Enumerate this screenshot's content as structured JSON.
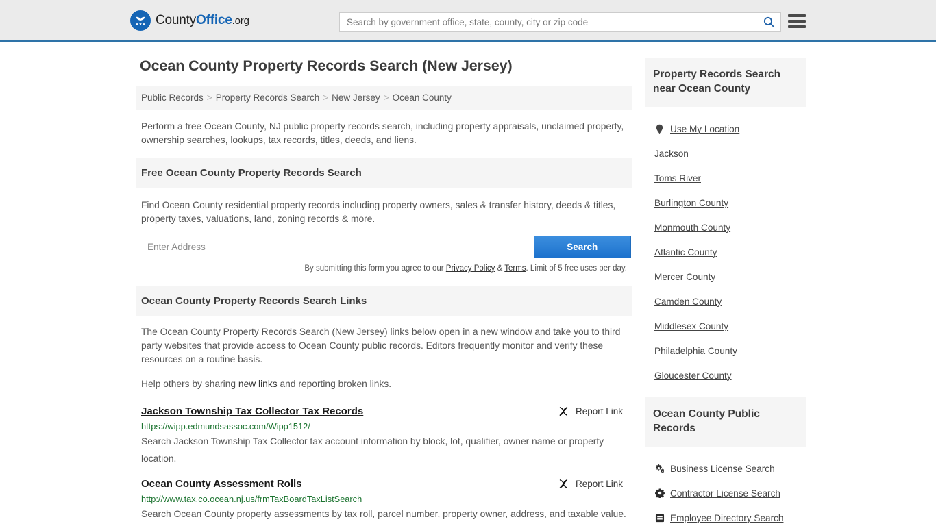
{
  "header": {
    "brand": {
      "part1": "County",
      "part2": "Office",
      "part3": ".org"
    },
    "search": {
      "placeholder": "Search by government office, state, county, city or zip code",
      "value": "",
      "icon": "search-icon"
    },
    "menu_icon": "hamburger-menu-icon",
    "accent_color": "#2e73a8"
  },
  "main": {
    "page_title": "Ocean County Property Records Search (New Jersey)",
    "breadcrumb": [
      "Public Records",
      "Property Records Search",
      "New Jersey",
      "Ocean County"
    ],
    "breadcrumb_separator": ">",
    "intro": "Perform a free Ocean County, NJ public property records search, including property appraisals, unclaimed property, ownership searches, lookups, tax records, titles, deeds, and liens.",
    "free_search": {
      "heading": "Free Ocean County Property Records Search",
      "description": "Find Ocean County residential property records including property owners, sales & transfer history, deeds & titles, property taxes, valuations, land, zoning records & more.",
      "input_placeholder": "Enter Address",
      "input_value": "",
      "submit_label": "Search",
      "terms_prefix": "By submitting this form you agree to our ",
      "terms_privacy": "Privacy Policy",
      "terms_amp": " & ",
      "terms_terms": "Terms",
      "terms_suffix": ". Limit of 5 free uses per day."
    },
    "links_section": {
      "heading": "Ocean County Property Records Search Links",
      "description": "The Ocean County Property Records Search (New Jersey) links below open in a new window and take you to third party websites that provide access to Ocean County public records. Editors frequently monitor and verify these resources on a routine basis.",
      "help_prefix": "Help others by sharing ",
      "help_link": "new links",
      "help_suffix": " and reporting broken links.",
      "report_label": "Report Link",
      "report_icon": "unlink-icon"
    },
    "results": [
      {
        "title": "Jackson Township Tax Collector Tax Records",
        "url": "https://wipp.edmundsassoc.com/Wipp1512/",
        "description": "Search Jackson Township Tax Collector tax account information by block, lot, qualifier, owner name or property location.",
        "report_label": "Report Link"
      },
      {
        "title": "Ocean County Assessment Rolls",
        "url": "http://www.tax.co.ocean.nj.us/frmTaxBoardTaxListSearch",
        "description": "Search Ocean County property assessments by tax roll, parcel number, property owner, address, and taxable value.",
        "report_label": "Report Link"
      }
    ]
  },
  "sidebar": {
    "nearby": {
      "heading": "Property Records Search near Ocean County",
      "items": [
        {
          "label": "Use My Location",
          "icon": "map-pin-icon"
        },
        {
          "label": "Jackson",
          "icon": ""
        },
        {
          "label": "Toms River",
          "icon": ""
        },
        {
          "label": "Burlington County",
          "icon": ""
        },
        {
          "label": "Monmouth County",
          "icon": ""
        },
        {
          "label": "Atlantic County",
          "icon": ""
        },
        {
          "label": "Mercer County",
          "icon": ""
        },
        {
          "label": "Camden County",
          "icon": ""
        },
        {
          "label": "Middlesex County",
          "icon": ""
        },
        {
          "label": "Philadelphia County",
          "icon": ""
        },
        {
          "label": "Gloucester County",
          "icon": ""
        }
      ]
    },
    "public_records": {
      "heading": "Ocean County Public Records",
      "items": [
        {
          "label": "Business License Search",
          "icon": "cogs-icon"
        },
        {
          "label": "Contractor License Search",
          "icon": "gear-icon"
        },
        {
          "label": "Employee Directory Search",
          "icon": "address-book-icon"
        }
      ]
    }
  },
  "colors": {
    "link_green": "#1c7430",
    "brand_blue": "#1565b5",
    "panel_gray": "#f5f5f5"
  }
}
